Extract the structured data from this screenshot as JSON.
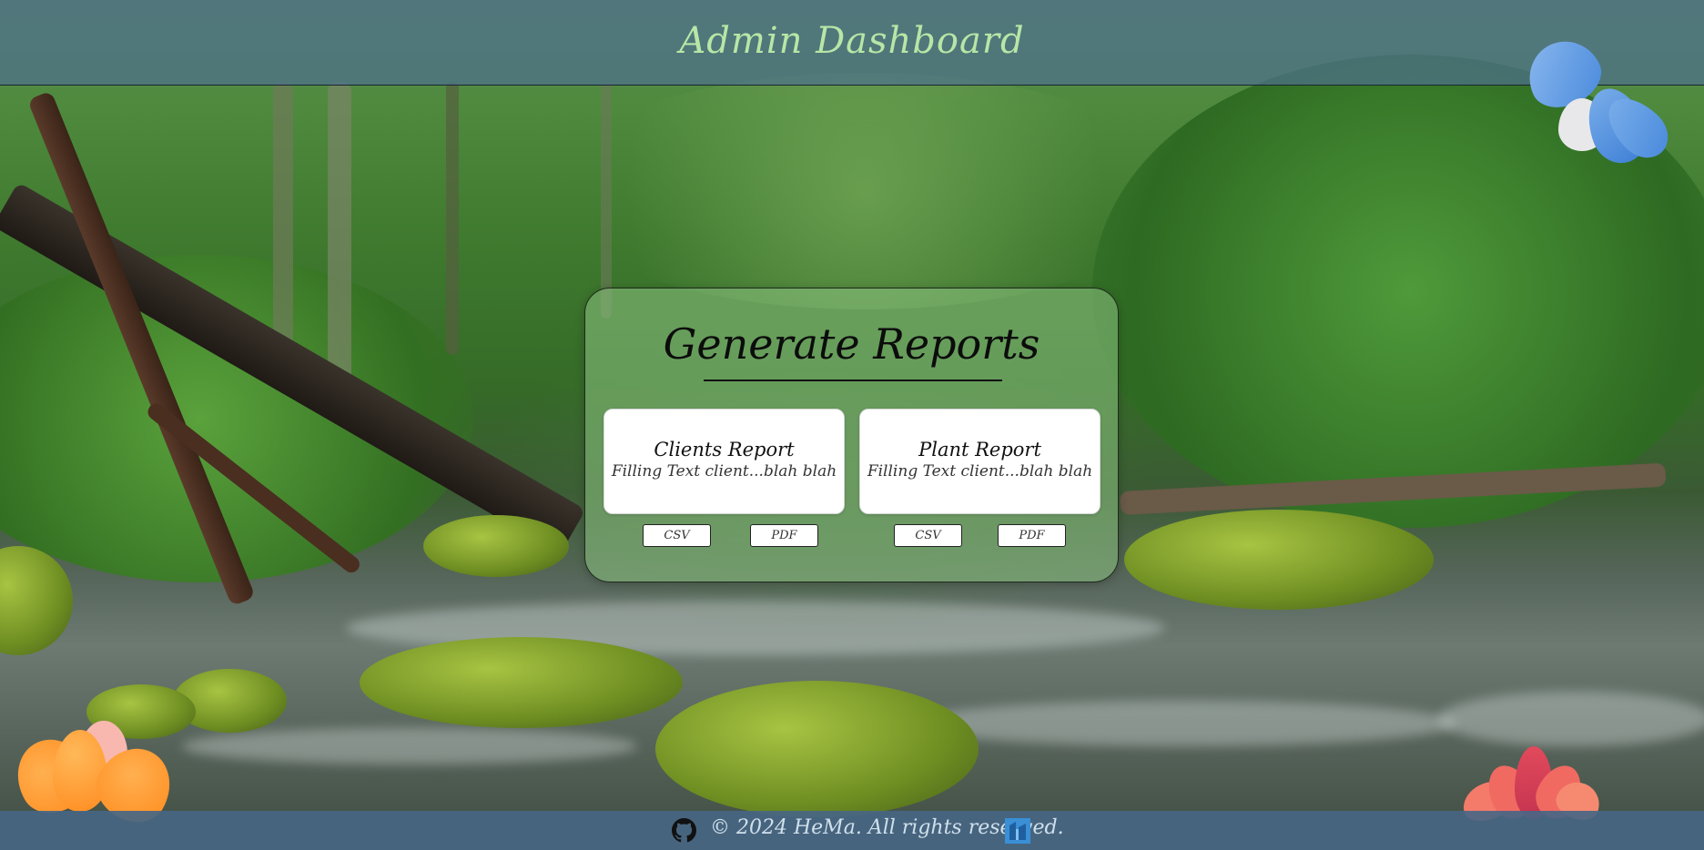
{
  "header": {
    "title": "Admin Dashboard"
  },
  "reports": {
    "title": "Generate Reports",
    "items": [
      {
        "title": "Clients Report",
        "description": "Filling Text client...blah blah",
        "buttons": [
          "CSV",
          "PDF"
        ]
      },
      {
        "title": "Plant Report",
        "description": "Filling Text client...blah blah",
        "buttons": [
          "CSV",
          "PDF"
        ]
      }
    ]
  },
  "footer": {
    "copyright": "© 2024 HeMa. All rights reserved.",
    "icons": [
      "github-icon",
      "site-icon"
    ]
  },
  "decorations": [
    "flower-blue",
    "flower-orange",
    "flower-pink"
  ],
  "colors": {
    "header_bg": "#4e708c",
    "title_green": "#b8e6a6",
    "card_bg": "#8cc382",
    "footer_bg": "#486684",
    "accent_blue": "#4a90d9"
  }
}
